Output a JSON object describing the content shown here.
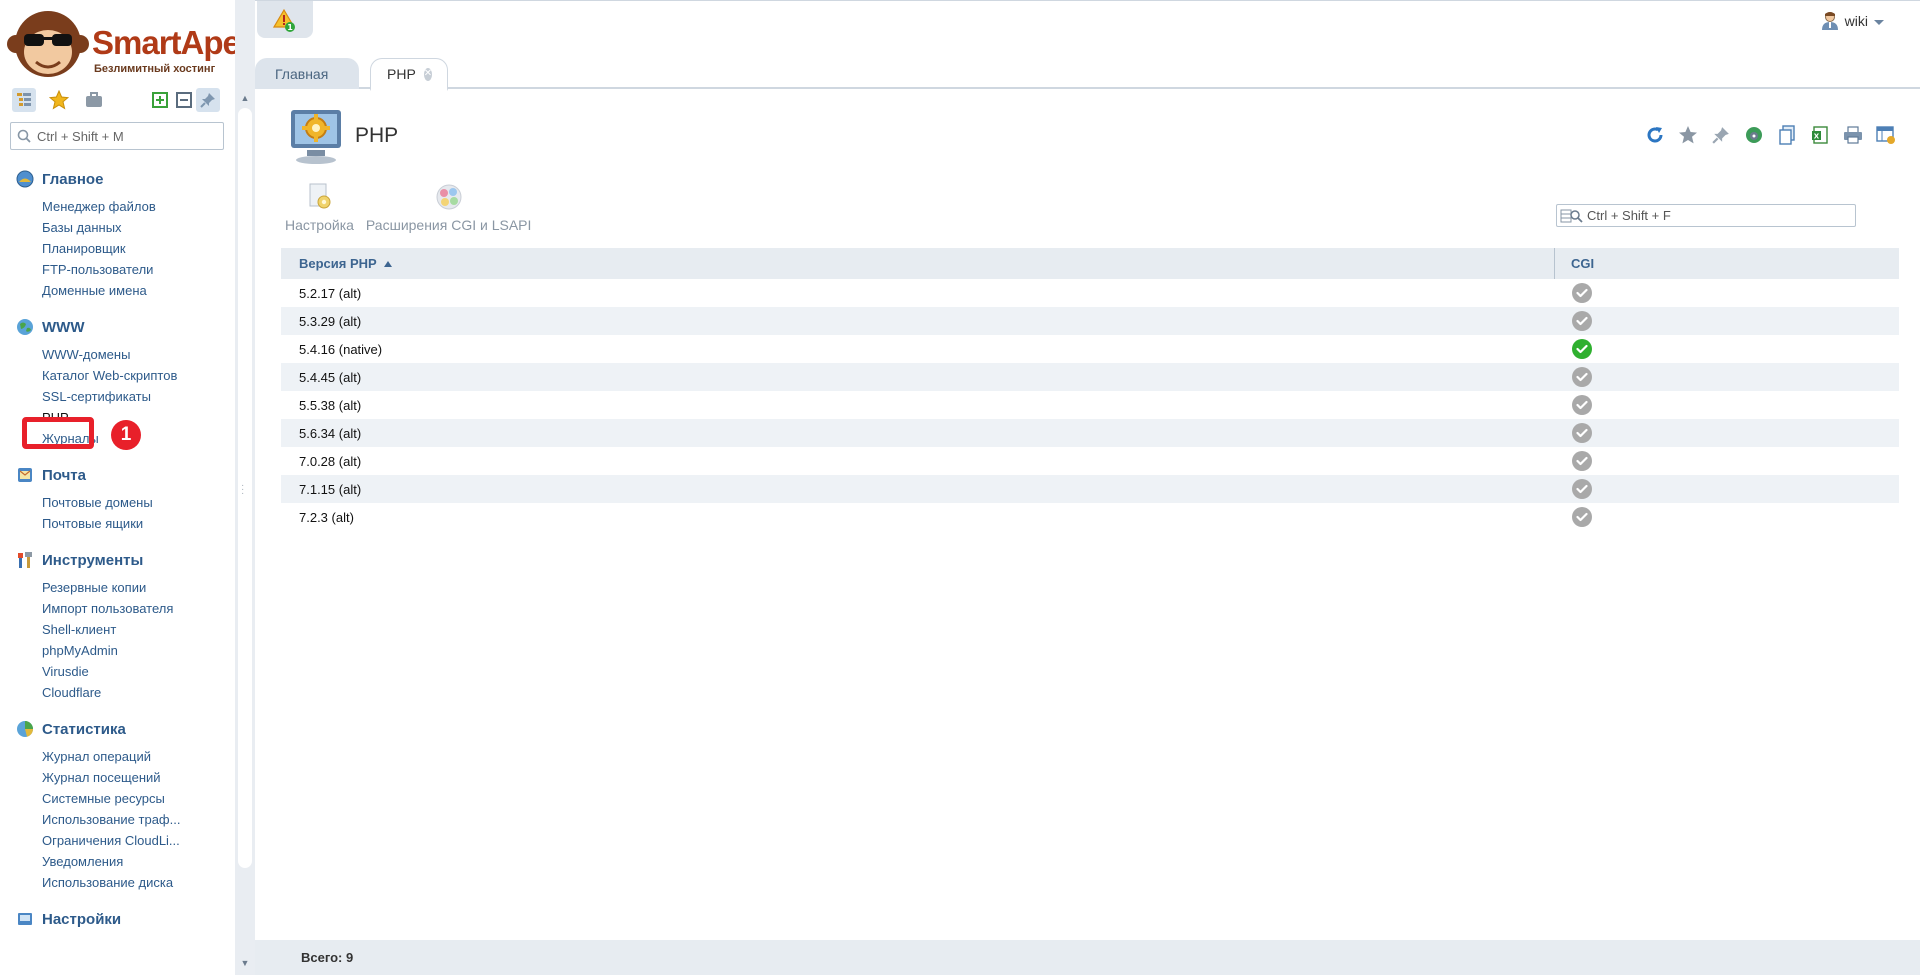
{
  "brand": {
    "name": "SmartApe",
    "tagline": "Безлимитный хостинг"
  },
  "sidebar": {
    "search_placeholder": "Ctrl + Shift + M",
    "groups": [
      {
        "label": "Главное",
        "icon": "home-globe-icon",
        "items": [
          "Менеджер файлов",
          "Базы данных",
          "Планировщик",
          "FTP-пользователи",
          "Доменные имена"
        ]
      },
      {
        "label": "WWW",
        "icon": "www-globe-icon",
        "items": [
          "WWW-домены",
          "Каталог Web-скриптов",
          "SSL-сертификаты",
          "PHP",
          "Журналы"
        ]
      },
      {
        "label": "Почта",
        "icon": "mail-icon",
        "items": [
          "Почтовые домены",
          "Почтовые ящики"
        ]
      },
      {
        "label": "Инструменты",
        "icon": "tools-icon",
        "items": [
          "Резервные копии",
          "Импорт пользователя",
          "Shell-клиент",
          "phpMyAdmin",
          "Virusdie",
          "Cloudflare"
        ]
      },
      {
        "label": "Статистика",
        "icon": "statistics-icon",
        "items": [
          "Журнал операций",
          "Журнал посещений",
          "Системные ресурсы",
          "Использование траф...",
          "Ограничения CloudLi...",
          "Уведомления",
          "Использование диска"
        ]
      },
      {
        "label": "Настройки",
        "icon": "settings-icon",
        "items": []
      }
    ],
    "step_marker": "1"
  },
  "topbar": {
    "alert_count": "1",
    "username": "wiki"
  },
  "tabs": [
    {
      "label": "Главная",
      "active": false
    },
    {
      "label": "PHP",
      "active": true
    }
  ],
  "page": {
    "title": "PHP"
  },
  "actions": [
    {
      "label": "Настройка",
      "icon": "settings-doc-icon"
    },
    {
      "label": "Расширения CGI и LSAPI",
      "icon": "extensions-icon"
    }
  ],
  "table_search_placeholder": "Ctrl + Shift + F",
  "table": {
    "columns": [
      "Версия PHP",
      "CGI"
    ],
    "sorted_by": "Версия PHP",
    "rows": [
      {
        "version": "5.2.17 (alt)",
        "cgi": false
      },
      {
        "version": "5.3.29 (alt)",
        "cgi": false
      },
      {
        "version": "5.4.16 (native)",
        "cgi": true
      },
      {
        "version": "5.4.45 (alt)",
        "cgi": false
      },
      {
        "version": "5.5.38 (alt)",
        "cgi": false
      },
      {
        "version": "5.6.34 (alt)",
        "cgi": false
      },
      {
        "version": "7.0.28 (alt)",
        "cgi": false
      },
      {
        "version": "7.1.15 (alt)",
        "cgi": false
      },
      {
        "version": "7.2.3 (alt)",
        "cgi": false
      }
    ]
  },
  "footer": {
    "total_label": "Всего: 9"
  },
  "colors": {
    "link": "#2d5a8a",
    "highlight": "#e8202a",
    "enabled": "#2fb02f",
    "disabled": "#a9a9a9",
    "brand": "#b03a17"
  }
}
